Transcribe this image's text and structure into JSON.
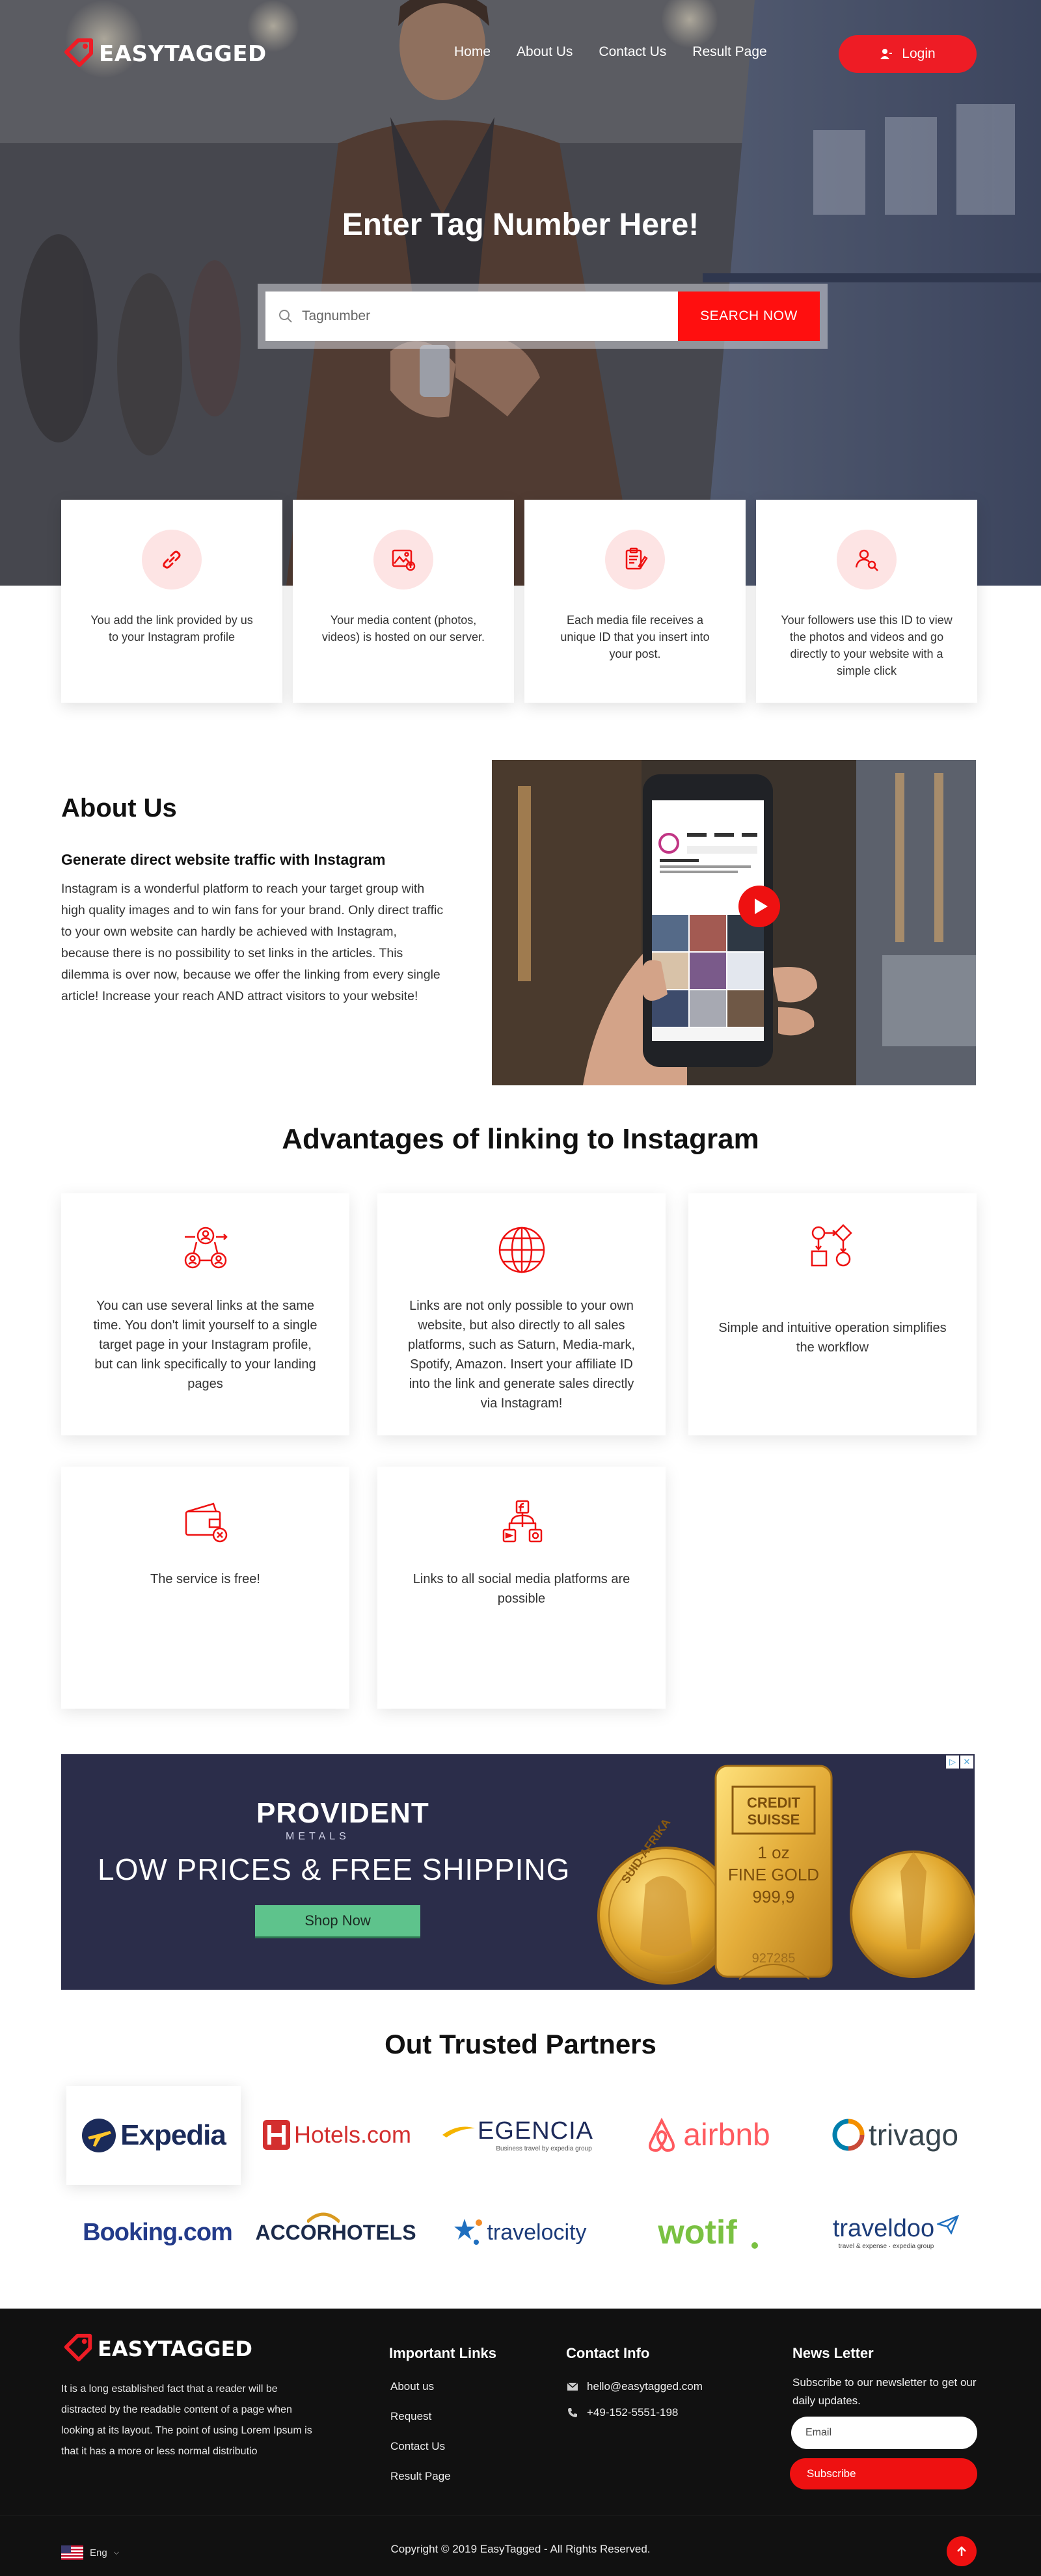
{
  "brand": {
    "name": "EASYTAGGED",
    "accent": "#ee1c25"
  },
  "nav": {
    "links": [
      "Home",
      "About Us",
      "Contact Us",
      "Result Page"
    ],
    "login_label": "Login"
  },
  "hero": {
    "title": "Enter Tag Number Here!",
    "search_placeholder": "Tagnumber",
    "search_button": "SEARCH NOW"
  },
  "features": [
    {
      "icon": "link-icon",
      "text": "You add the link provided by us to your Instagram profile"
    },
    {
      "icon": "image-upload-icon",
      "text": "Your media content (photos, videos) is hosted on our server."
    },
    {
      "icon": "clipboard-edit-icon",
      "text": "Each media file receives a unique ID that you insert into your post."
    },
    {
      "icon": "user-search-icon",
      "text": "Your followers use this ID to view the photos and videos and go directly to your website with a simple click"
    }
  ],
  "about": {
    "title": "About Us",
    "subtitle": "Generate direct website traffic with Instagram",
    "body": "Instagram is a wonderful platform to reach your target group with high quality images and to win fans for your brand. Only direct traffic to your own website can hardly be achieved with Instagram, because there is no possibility to set links in the articles. This dilemma is over now, because we offer the linking from every single article! Increase your reach AND attract visitors to your website!"
  },
  "advantages": {
    "title": "Advantages of linking to Instagram",
    "items": [
      {
        "icon": "network-users-icon",
        "text": "You can use several links at the same time. You don't limit yourself to a single target page in your Instagram profile, but can link specifically to your landing pages"
      },
      {
        "icon": "globe-icon",
        "text": "Links are not only possible to your own website, but also directly to all sales platforms, such as Saturn, Media-mark, Spotify, Amazon. Insert your affiliate ID into the link and generate sales directly via Instagram!"
      },
      {
        "icon": "workflow-icon",
        "text": "Simple and intuitive operation simplifies the workflow"
      },
      {
        "icon": "wallet-icon",
        "text": "The service is free!"
      },
      {
        "icon": "social-share-icon",
        "text": "Links to all social media platforms are possible"
      }
    ]
  },
  "ad": {
    "brand": "PROVIDENT",
    "brand_sub": "METALS",
    "headline": "LOW PRICES & FREE SHIPPING",
    "cta": "Shop Now",
    "bar_line1": "CREDIT",
    "bar_line2": "SUISSE",
    "bar_line3": "1 oz",
    "bar_line4": "FINE GOLD",
    "bar_line5": "999,9",
    "bar_serial": "927285",
    "coin_text": "SUID-AFRIKA"
  },
  "partners": {
    "title": "Out Trusted Partners",
    "logos": [
      "Expedia",
      "Hotels.com",
      "EGENCIA",
      "airbnb",
      "trivago",
      "Booking.com",
      "ACCORHOTELS",
      "travelocity",
      "wotif",
      "traveldoo"
    ],
    "egencia_tagline": "Business travel by expedia group",
    "traveldoo_tagline": "travel & expense · expedia group"
  },
  "footer": {
    "about": "It is a long established fact that a reader will be distracted by the readable content of a page when looking at its layout. The point of using Lorem Ipsum is that it has a more or less normal distributio",
    "links_title": "Important Links",
    "links": [
      "About us",
      "Request",
      "Contact Us",
      "Result Page"
    ],
    "contact_title": "Contact Info",
    "email": "hello@easytagged.com",
    "phone": "+49-152-5551-198",
    "news_title": "News Letter",
    "news_text": "Subscribe to our newsletter to get our daily updates.",
    "email_placeholder": "Email",
    "subscribe_label": "Subscribe",
    "language": "Eng",
    "copyright": "Copyright © 2019 EasyTagged - All Rights Reserved."
  }
}
